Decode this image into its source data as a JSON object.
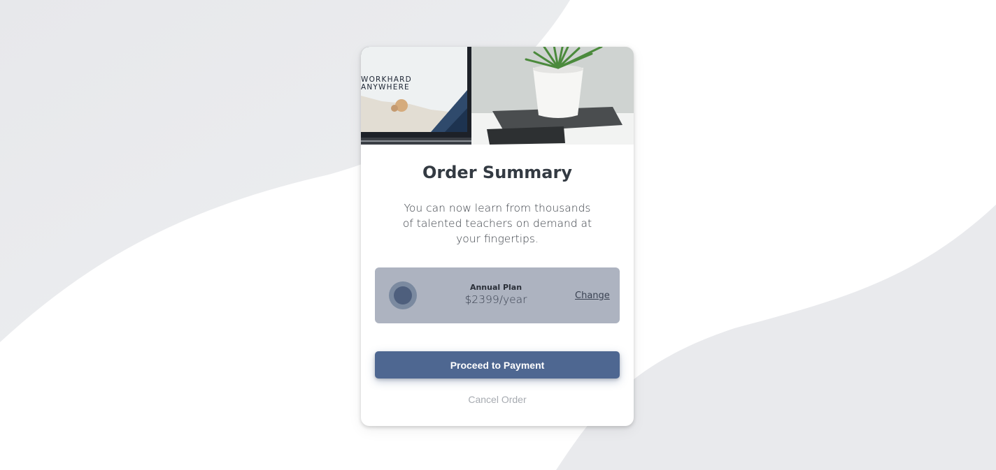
{
  "card": {
    "hero_caption_line1": "WORKHARD",
    "hero_caption_line2": "ANYWHERE",
    "title": "Order Summary",
    "description": "You can now learn from thousands of talented teachers on demand at your fingertips.",
    "plan": {
      "name": "Annual Plan",
      "price": "$2399/year",
      "change_label": "Change",
      "icon": "music-disc-icon"
    },
    "proceed_label": "Proceed to Payment",
    "cancel_label": "Cancel Order"
  },
  "colors": {
    "accent": "#4e6791",
    "plan_bg": "#adb3c0",
    "background_wave": "#e8e9ec"
  }
}
